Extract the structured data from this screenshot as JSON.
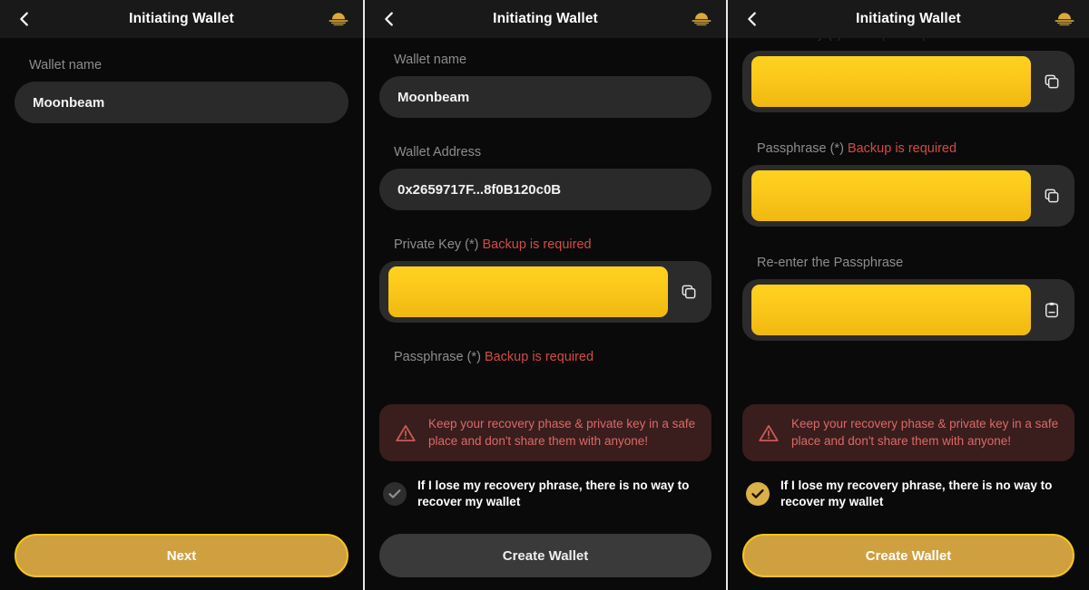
{
  "app": {
    "title": "Initiating Wallet",
    "logo_icon": "moonbeam-logo-icon",
    "back_icon": "chevron-left-icon",
    "colors": {
      "accent_gold": "#cfa040",
      "accent_yellow": "#f5c518",
      "redaction": "#fbc81a",
      "danger": "#d44a48",
      "warn_bg": "#3a1d1d",
      "warn_text": "#d96a66",
      "field_bg": "#2a2a2a",
      "page_bg": "#0a0a0a",
      "header_bg": "#191919"
    }
  },
  "shared": {
    "warning": {
      "icon": "alert-triangle-icon",
      "text": "Keep your recovery phase & private key in a safe place and don't share them with anyone!"
    },
    "acknowledgement": {
      "icon": "check-circle-icon",
      "text": "If I lose my recovery phrase, there is no way to recover my wallet"
    },
    "copy_icon": "copy-icon",
    "paste_icon": "paste-clipboard-icon",
    "required_marker": "(*)",
    "backup_required": "Backup is required"
  },
  "panel1": {
    "title": "Initiating Wallet",
    "wallet_name": {
      "label": "Wallet name",
      "value": "Moonbeam",
      "placeholder": "Wallet name"
    },
    "cta": {
      "label": "Next",
      "state": "active"
    }
  },
  "panel2": {
    "title": "Initiating Wallet",
    "wallet_name": {
      "label": "Wallet name",
      "value": "Moonbeam",
      "placeholder": "Wallet name"
    },
    "wallet_address": {
      "label": "Wallet Address",
      "value": "0x2659717F...8f0B120c0B"
    },
    "private_key": {
      "label_main": "Private Key (*)",
      "label_warn": "Backup is required",
      "value": "",
      "redacted": true,
      "action_icon": "copy-icon"
    },
    "passphrase_cut": {
      "label_main": "Passphrase (*)",
      "label_warn": "Backup is required"
    },
    "cta": {
      "label": "Create Wallet",
      "state": "disabled"
    },
    "ack_checked": false
  },
  "panel3": {
    "title": "Initiating Wallet",
    "private_key": {
      "value": "",
      "redacted": true,
      "action_icon": "copy-icon"
    },
    "passphrase": {
      "label_main": "Passphrase (*)",
      "label_warn": "Backup is required",
      "value": "",
      "redacted": true,
      "action_icon": "copy-icon"
    },
    "reenter_passphrase": {
      "label": "Re-enter the Passphrase",
      "value": "",
      "redacted": true,
      "action_icon": "paste-clipboard-icon"
    },
    "cta": {
      "label": "Create Wallet",
      "state": "active"
    },
    "ack_checked": true
  }
}
